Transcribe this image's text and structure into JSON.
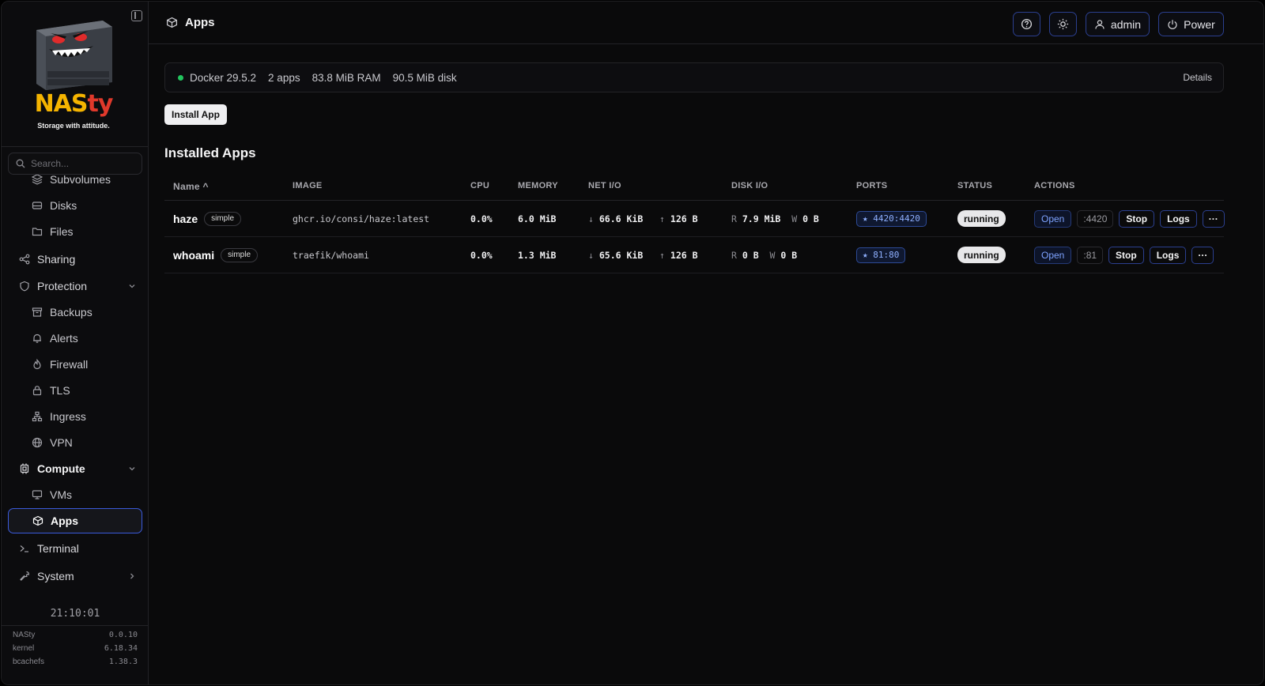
{
  "window": {
    "title": "Apps"
  },
  "brand": {
    "name_part1": "NAS",
    "name_part2": "ty",
    "tagline": "Storage with attitude."
  },
  "search": {
    "placeholder": "Search..."
  },
  "sidebar": {
    "items": [
      {
        "label": "Subvolumes",
        "icon": "layers-icon"
      },
      {
        "label": "Disks",
        "icon": "drive-icon"
      },
      {
        "label": "Files",
        "icon": "folder-icon"
      },
      {
        "label": "Sharing",
        "icon": "share-icon"
      },
      {
        "label": "Protection",
        "icon": "shield-icon",
        "expanded": true
      },
      {
        "label": "Backups",
        "icon": "archive-icon"
      },
      {
        "label": "Alerts",
        "icon": "bell-icon"
      },
      {
        "label": "Firewall",
        "icon": "flame-icon"
      },
      {
        "label": "TLS",
        "icon": "lock-icon"
      },
      {
        "label": "Ingress",
        "icon": "network-icon"
      },
      {
        "label": "VPN",
        "icon": "globe-icon"
      },
      {
        "label": "Compute",
        "icon": "cpu-icon",
        "expanded": true
      },
      {
        "label": "VMs",
        "icon": "monitor-icon"
      },
      {
        "label": "Apps",
        "icon": "box-icon",
        "active": true
      },
      {
        "label": "Terminal",
        "icon": "terminal-icon"
      },
      {
        "label": "System",
        "icon": "wrench-icon"
      }
    ]
  },
  "clock": "21:10:01",
  "versions": [
    {
      "name": "NASty",
      "value": "0.0.10"
    },
    {
      "name": "kernel",
      "value": "6.18.34"
    },
    {
      "name": "bcachefs",
      "value": "1.38.3"
    }
  ],
  "topbar": {
    "title": "Apps",
    "user_label": "admin",
    "power_label": "Power"
  },
  "docker": {
    "version": "Docker 29.5.2",
    "apps": "2 apps",
    "ram": "83.8 MiB RAM",
    "disk": "90.5 MiB disk",
    "details_label": "Details",
    "status_color": "#22c55e"
  },
  "install_label": "Install App",
  "section_title": "Installed Apps",
  "table": {
    "headers": {
      "name": "Name",
      "image": "IMAGE",
      "cpu": "CPU",
      "memory": "MEMORY",
      "net": "NET I/O",
      "disk": "DISK I/O",
      "ports": "PORTS",
      "status": "STATUS",
      "actions": "ACTIONS"
    },
    "rows": [
      {
        "name": "haze",
        "badge": "simple",
        "image": "ghcr.io/consi/haze:latest",
        "cpu": "0.0%",
        "memory": "6.0 MiB",
        "net_down": "↓",
        "net_down_val": "66.6 KiB",
        "net_up": "↑",
        "net_up_val": "126 B",
        "disk_r": "R",
        "disk_r_val": "7.9 MiB",
        "disk_w": "W",
        "disk_w_val": "0 B",
        "port": "★ 4420:4420",
        "status": "running",
        "open": "Open",
        "port_short": ":4420",
        "stop": "Stop",
        "logs": "Logs",
        "more": "···"
      },
      {
        "name": "whoami",
        "badge": "simple",
        "image": "traefik/whoami",
        "cpu": "0.0%",
        "memory": "1.3 MiB",
        "net_down": "↓",
        "net_down_val": "65.6 KiB",
        "net_up": "↑",
        "net_up_val": "126 B",
        "disk_r": "R",
        "disk_r_val": "0 B",
        "disk_w": "W",
        "disk_w_val": "0 B",
        "port": "★ 81:80",
        "status": "running",
        "open": "Open",
        "port_short": ":81",
        "stop": "Stop",
        "logs": "Logs",
        "more": "···"
      }
    ]
  }
}
